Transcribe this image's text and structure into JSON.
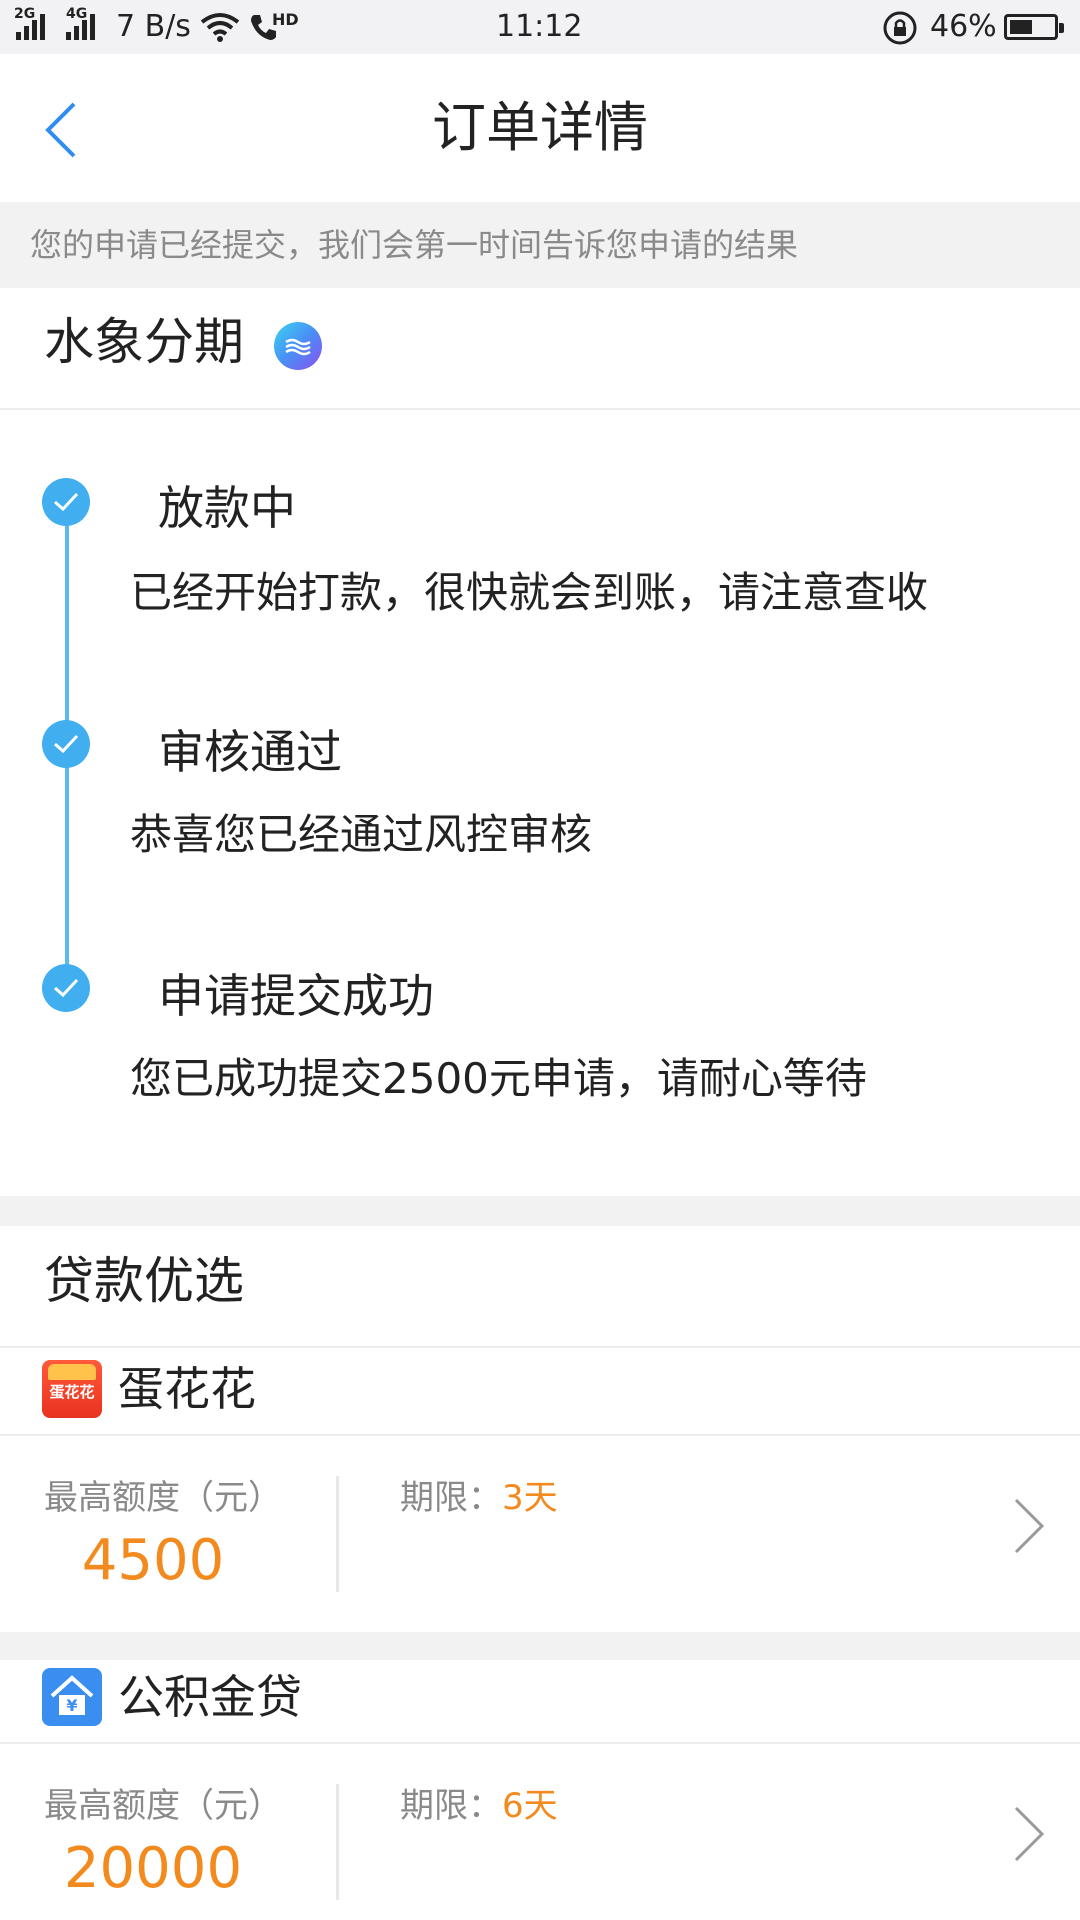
{
  "status_bar": {
    "net1": "2G",
    "net2": "4G",
    "speed": "7 B/s",
    "hd": "HD",
    "time": "11:12",
    "battery": "46%"
  },
  "header": {
    "title": "订单详情"
  },
  "notice": "您的申请已经提交，我们会第一时间告诉您申请的结果",
  "product": {
    "name": "水象分期"
  },
  "timeline": [
    {
      "title": "放款中",
      "desc": "已经开始打款，很快就会到账，请注意查收"
    },
    {
      "title": "审核通过",
      "desc": "恭喜您已经通过风控审核"
    },
    {
      "title": "申请提交成功",
      "desc": "您已成功提交2500元申请，请耐心等待"
    }
  ],
  "recommend": {
    "title": "贷款优选",
    "loans": [
      {
        "name": "蛋花花",
        "icon_text": "蛋花花",
        "quota_label": "最高额度（元）",
        "quota": "4500",
        "term_label": "期限：",
        "term": "3天"
      },
      {
        "name": "公积金贷",
        "icon_text": "¥",
        "quota_label": "最高额度（元）",
        "quota": "20000",
        "term_label": "期限：",
        "term": "6天"
      }
    ]
  },
  "colors": {
    "accent_blue": "#41aef0",
    "highlight_orange": "#f28a1e"
  }
}
